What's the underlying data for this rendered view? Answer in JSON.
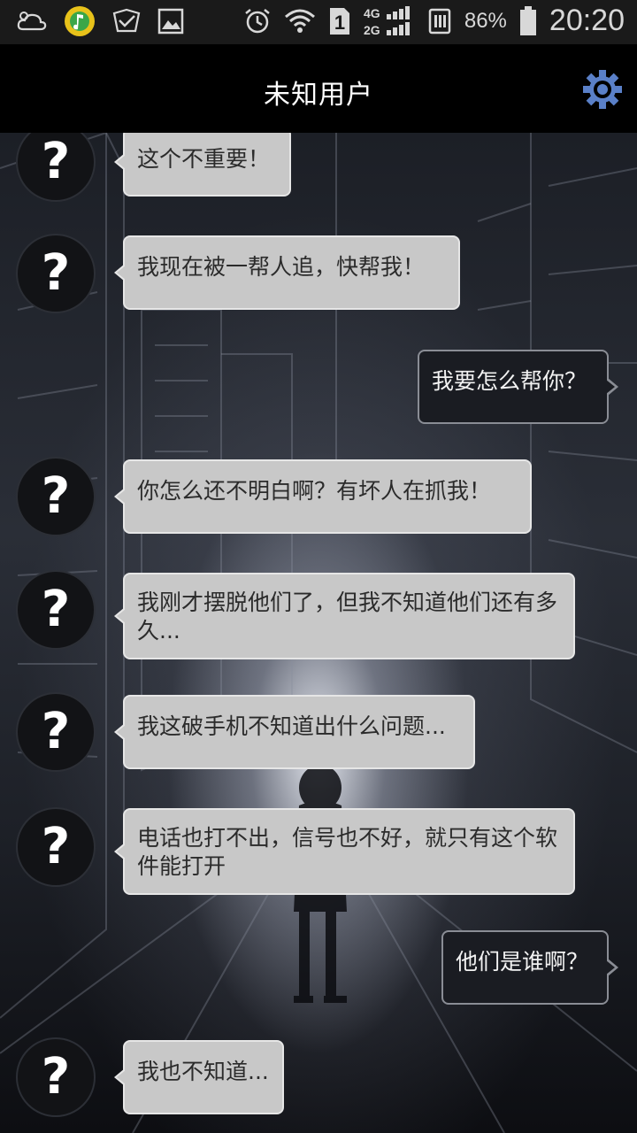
{
  "status_bar": {
    "time": "20:20",
    "battery_percent": "86%",
    "sim_slot": "1",
    "network_top": "4G",
    "network_bottom": "2G",
    "icons": [
      "weather-cloud-icon",
      "music-app-icon",
      "mail-shield-icon",
      "gallery-icon",
      "alarm-icon",
      "wifi-icon",
      "sim-icon",
      "signal-icon",
      "data-icon",
      "battery-icon"
    ]
  },
  "header": {
    "title": "未知用户",
    "settings_icon": "gear-icon",
    "accent_color": "#5a80c8"
  },
  "chat": {
    "avatar_glyph": "?",
    "messages": [
      {
        "side": "in",
        "text": "这个不重要！"
      },
      {
        "side": "in",
        "text": "我现在被一帮人追，快帮我！"
      },
      {
        "side": "out",
        "text": "我要怎么帮你？"
      },
      {
        "side": "in",
        "text": "你怎么还不明白啊？有坏人在抓我！"
      },
      {
        "side": "in",
        "text": "我刚才摆脱他们了，但我不知道他们还有多久..."
      },
      {
        "side": "in",
        "text": "我这破手机不知道出什么问题..."
      },
      {
        "side": "in",
        "text": "电话也打不出，信号也不好，就只有这个软件能打开"
      },
      {
        "side": "out",
        "text": "他们是谁啊？"
      },
      {
        "side": "in",
        "text": "我也不知道..."
      }
    ]
  }
}
